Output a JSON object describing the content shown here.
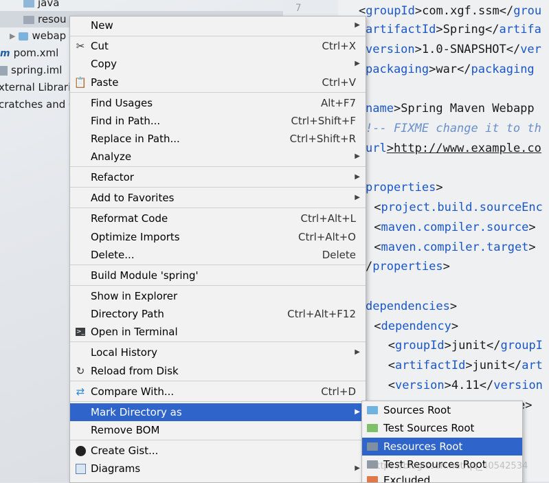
{
  "tree": {
    "items": [
      {
        "label": "java"
      },
      {
        "label": "resou"
      },
      {
        "label": "webap"
      },
      {
        "label": "pom.xml"
      },
      {
        "label": "spring.iml"
      },
      {
        "label": "xternal Librarie"
      },
      {
        "label": "cratches and C"
      }
    ]
  },
  "gutter": {
    "line_number": "7"
  },
  "editor": {
    "lines": [
      {
        "pre": "<",
        "tag": "groupId",
        "text": ">com.xgf.ssm</",
        "tag2": "grou"
      },
      {
        "pre": "",
        "tag": "artifactId",
        "text": ">Spring</",
        "tag2": "artifa"
      },
      {
        "pre": "",
        "tag": "version",
        "text": ">1.0-SNAPSHOT</",
        "tag2": "ver"
      },
      {
        "pre": "",
        "tag": "packaging",
        "text": ">war</",
        "tag2": "packaging"
      },
      {
        "pre": "",
        "tag": "name",
        "text": ">Spring Maven Webapp",
        "tag2": ""
      },
      {
        "comment": "!-- FIXME change it to th"
      },
      {
        "pre": "",
        "tag": "url",
        "text": ">http://www.example.co",
        "tag2": ""
      },
      {
        "pre": "",
        "tag": "properties",
        "text": ">",
        "tag2": ""
      },
      {
        "pre": " <",
        "tag": "project.build.sourceEnc",
        "text": "",
        "tag2": ""
      },
      {
        "pre": " <",
        "tag": "maven.compiler.source",
        "text": ">",
        "tag2": ""
      },
      {
        "pre": " <",
        "tag": "maven.compiler.target",
        "text": ">",
        "tag2": ""
      },
      {
        "pre": "/",
        "tag": "properties",
        "text": ">",
        "tag2": ""
      },
      {
        "pre": "",
        "tag": "dependencies",
        "text": ">",
        "tag2": ""
      },
      {
        "pre": " <",
        "tag": "dependency",
        "text": ">",
        "tag2": ""
      },
      {
        "pre": "   <",
        "tag": "groupId",
        "text": ">junit</",
        "tag2": "groupI"
      },
      {
        "pre": "   <",
        "tag": "artifactId",
        "text": ">junit</",
        "tag2": "art"
      },
      {
        "pre": "   <",
        "tag": "version",
        "text": ">4.11</",
        "tag2": "version"
      },
      {
        "pre": "",
        "tag": "",
        "text": "e>",
        "tag2": ""
      }
    ]
  },
  "menu": {
    "items": [
      {
        "label": "New",
        "shortcut": "",
        "submenu": true,
        "icon": ""
      },
      {
        "label": "Cut",
        "shortcut": "Ctrl+X",
        "submenu": false,
        "icon": "scissors-icon"
      },
      {
        "label": "Copy",
        "shortcut": "",
        "submenu": true,
        "icon": ""
      },
      {
        "label": "Paste",
        "shortcut": "Ctrl+V",
        "submenu": false,
        "icon": "clipboard-icon"
      },
      {
        "label": "Find Usages",
        "shortcut": "Alt+F7",
        "submenu": false,
        "icon": ""
      },
      {
        "label": "Find in Path...",
        "shortcut": "Ctrl+Shift+F",
        "submenu": false,
        "icon": ""
      },
      {
        "label": "Replace in Path...",
        "shortcut": "Ctrl+Shift+R",
        "submenu": false,
        "icon": ""
      },
      {
        "label": "Analyze",
        "shortcut": "",
        "submenu": true,
        "icon": ""
      },
      {
        "label": "Refactor",
        "shortcut": "",
        "submenu": true,
        "icon": ""
      },
      {
        "label": "Add to Favorites",
        "shortcut": "",
        "submenu": true,
        "icon": ""
      },
      {
        "label": "Reformat Code",
        "shortcut": "Ctrl+Alt+L",
        "submenu": false,
        "icon": ""
      },
      {
        "label": "Optimize Imports",
        "shortcut": "Ctrl+Alt+O",
        "submenu": false,
        "icon": ""
      },
      {
        "label": "Delete...",
        "shortcut": "Delete",
        "submenu": false,
        "icon": ""
      },
      {
        "label": "Build Module 'spring'",
        "shortcut": "",
        "submenu": false,
        "icon": ""
      },
      {
        "label": "Show in Explorer",
        "shortcut": "",
        "submenu": false,
        "icon": ""
      },
      {
        "label": "Directory Path",
        "shortcut": "Ctrl+Alt+F12",
        "submenu": false,
        "icon": ""
      },
      {
        "label": "Open in Terminal",
        "shortcut": "",
        "submenu": false,
        "icon": "terminal-icon"
      },
      {
        "label": "Local History",
        "shortcut": "",
        "submenu": true,
        "icon": ""
      },
      {
        "label": "Reload from Disk",
        "shortcut": "",
        "submenu": false,
        "icon": "reload-icon"
      },
      {
        "label": "Compare With...",
        "shortcut": "Ctrl+D",
        "submenu": false,
        "icon": "compare-icon"
      },
      {
        "label": "Mark Directory as",
        "shortcut": "",
        "submenu": true,
        "icon": "",
        "highlighted": true
      },
      {
        "label": "Remove BOM",
        "shortcut": "",
        "submenu": false,
        "icon": ""
      },
      {
        "label": "Create Gist...",
        "shortcut": "",
        "submenu": false,
        "icon": "github-icon"
      },
      {
        "label": "Diagrams",
        "shortcut": "",
        "submenu": true,
        "icon": "diagram-icon"
      }
    ]
  },
  "submenu": {
    "items": [
      {
        "label": "Sources Root",
        "color": "#6fb3e0"
      },
      {
        "label": "Test Sources Root",
        "color": "#7fbf6a"
      },
      {
        "label": "Resources Root",
        "color": "#7e8ea3",
        "highlighted": true
      },
      {
        "label": "Test Resources Root",
        "color": "#8f9aa5"
      },
      {
        "label": "Excluded",
        "color": "#e0784a"
      }
    ]
  },
  "watermark": "https://blog.csdn.net/qq_40542534",
  "colors": {
    "highlight": "#2f65ca",
    "menu_bg": "#f2f2f2",
    "xml_tag": "#1a56c8"
  }
}
